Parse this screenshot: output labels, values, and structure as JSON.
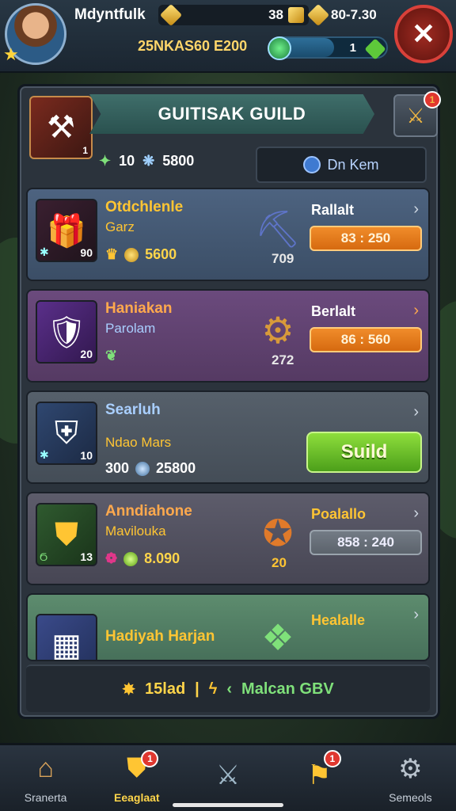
{
  "player": {
    "name": "Mdyntfulk"
  },
  "resources": {
    "res_a": "38",
    "res_b": "80-7.30"
  },
  "progress": {
    "text": "25NKAS60 E200",
    "count": "1",
    "fill_fraction": 0.55
  },
  "panel": {
    "title": "GUITISAK GUILD",
    "guild_badge": "1",
    "mail_badge": "1",
    "stat_a": "10",
    "stat_b": "5800",
    "info_button": "Dn Kem"
  },
  "cards": [
    {
      "title": "Otdchlenle",
      "subtitle": "Garz",
      "thumb_num": "90",
      "stat_value": "5600",
      "item_num": "709",
      "right_title": "Rallalt",
      "timer": "83 : 250"
    },
    {
      "title": "Haniakan",
      "subtitle": "Parolam",
      "thumb_num": "20",
      "item_num": "272",
      "right_title": "Berlalt",
      "timer": "86 : 560"
    },
    {
      "title": "Searluh",
      "subtitle": "Ndao Mars",
      "thumb_num": "10",
      "stat_a": "300",
      "stat_b": "25800",
      "button": "Suild"
    },
    {
      "title": "Anndiahone",
      "subtitle": "Mavilouka",
      "thumb_num": "13",
      "stat_value": "8.090",
      "item_num": "20",
      "right_title": "Poalallo",
      "timer": "858 : 240"
    },
    {
      "title": "Hadiyah Harjan",
      "right_title": "Healalle"
    }
  ],
  "footer": {
    "left": "15lad",
    "sep": "|",
    "right": "Malcan GBV"
  },
  "nav": {
    "items": [
      {
        "label": "Sranerta"
      },
      {
        "label": "Eeaglaat",
        "badge": "1"
      },
      {
        "label": ""
      },
      {
        "label": "",
        "badge": "1"
      },
      {
        "label": "Semeols"
      }
    ]
  },
  "colors": {
    "accent_gold": "#ffc533",
    "timer_orange": "#e07a1a",
    "guild_green": "#6cc12c",
    "close_red": "#d9413a"
  }
}
